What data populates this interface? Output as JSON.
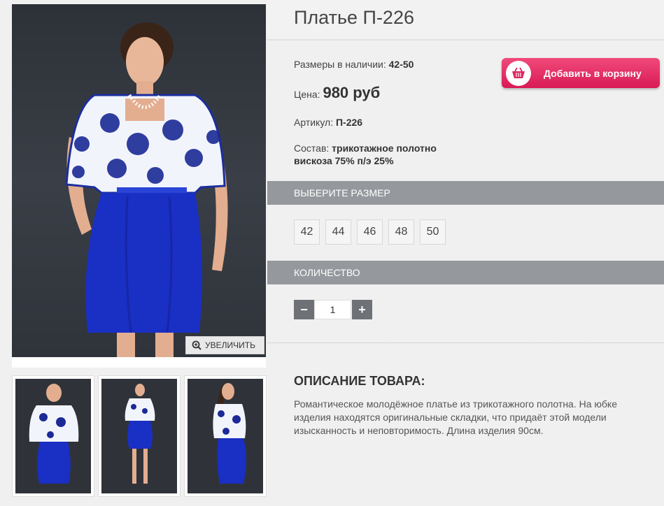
{
  "product": {
    "title": "Платье П-226",
    "sizes_label": "Размеры в наличии:",
    "sizes_value": "42-50",
    "price_label": "Цена:",
    "price_value": "980 руб",
    "sku_label": "Артикул:",
    "sku_value": "П-226",
    "composition_label": "Состав:",
    "composition_line1": "трикотажное полотно",
    "composition_line2": "вискоза 75% п/э 25%"
  },
  "cart": {
    "add_label": "Добавить в корзину",
    "icon": "basket-icon"
  },
  "gallery": {
    "zoom_label": "УВЕЛИЧИТЬ",
    "zoom_icon": "magnifier-plus-icon",
    "thumbnails": 3
  },
  "size_section": {
    "title": "ВЫБЕРИТЕ РАЗМЕР",
    "options": [
      "42",
      "44",
      "46",
      "48",
      "50"
    ]
  },
  "quantity_section": {
    "title": "КОЛИЧЕСТВО",
    "minus": "−",
    "plus": "+",
    "value": "1"
  },
  "description": {
    "title": "ОПИСАНИЕ ТОВАРА:",
    "text": "Романтическое молодёжное платье из трикотажного полотна. На юбке изделия находятся оригинальные складки, что придаёт этой модели изысканность и неповторимость. Длина изделия 90см."
  },
  "colors": {
    "cart_button": "#e0245e",
    "section_bar": "#95999d",
    "qty_button": "#6e7276",
    "dress_blue": "#1a2fc4"
  }
}
